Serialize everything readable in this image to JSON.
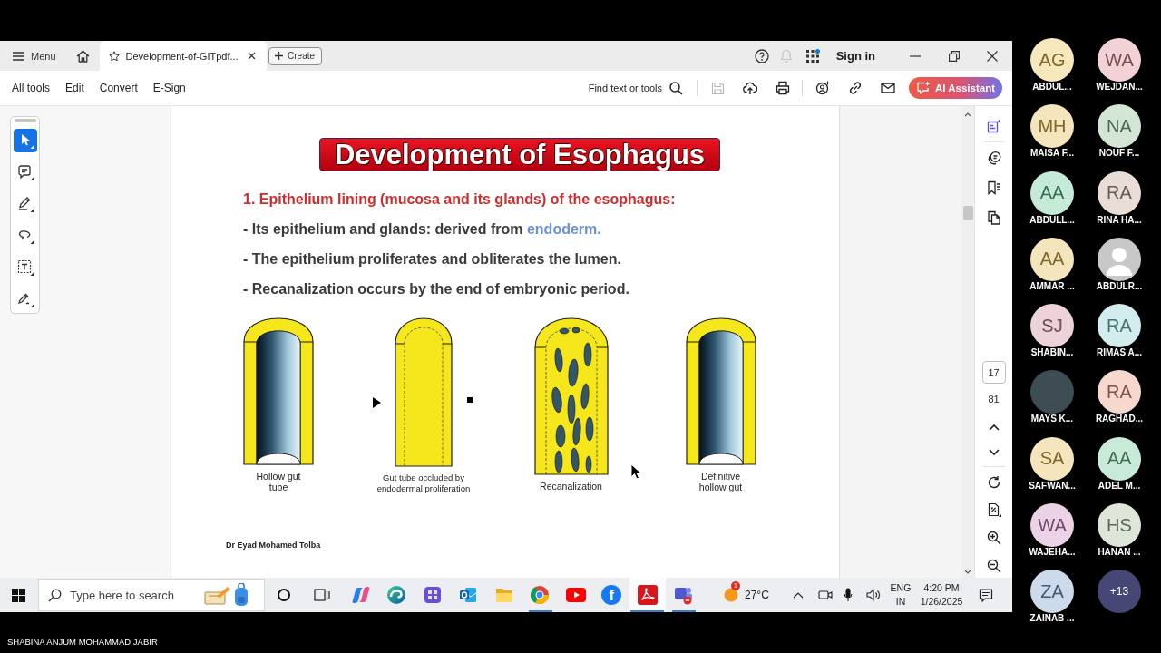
{
  "window": {
    "tab_bar": {
      "menu_label": "Menu",
      "tabs": [
        {
          "title": "Development-of-GITpdf...",
          "selected": true
        }
      ],
      "create_label": "Create",
      "notifications": {
        "disabled": true
      },
      "sign_in": "Sign in"
    },
    "toolbar": {
      "menu_items": [
        "All tools",
        "Edit",
        "Convert",
        "E-Sign"
      ],
      "find_label": "Find text or tools",
      "save": {
        "disabled": true
      },
      "ai_button": "AI Assistant"
    },
    "tools": [
      {
        "selected": true
      },
      {
        "selected": false
      },
      {
        "selected": false
      },
      {
        "selected": false
      },
      {
        "selected": false
      },
      {
        "selected": false
      }
    ],
    "page": {
      "title": "Development of Esophagus",
      "heading": "1. Epithelium lining (mucosa and its glands) of the esophagus:",
      "lines": [
        {
          "text": "- Its epithelium and glands: derived from",
          "highlight": "endoderm."
        },
        {
          "text": "- The epithelium proliferates and obliterates the lumen."
        },
        {
          "text": "- Recanalization occurs by the end of embryonic period."
        }
      ],
      "figures": [
        {
          "kind": "hollow",
          "caption": "Hollow gut tube"
        },
        {
          "kind": "occluded",
          "caption": "Gut tube occluded by endodermal proliferation"
        },
        {
          "kind": "recanalized",
          "caption": "Recanalization"
        },
        {
          "kind": "hollow",
          "caption": "Definitive hollow gut"
        }
      ],
      "footer": "Dr Eyad Mohamed Tolba"
    },
    "page_nav": {
      "page_field": {
        "value": "17"
      },
      "total": "81"
    }
  },
  "taskbar": {
    "search": {
      "placeholder": "Type here to search"
    },
    "apps": [
      {
        "running": false,
        "selected": false
      },
      {
        "running": false,
        "selected": false
      },
      {
        "running": false,
        "selected": false
      },
      {
        "running": false,
        "selected": false
      },
      {
        "running": false,
        "selected": false
      },
      {
        "running": true,
        "selected": false
      },
      {
        "running": false,
        "selected": false
      },
      {
        "running": false,
        "selected": false,
        "label": "f"
      },
      {
        "running": true,
        "selected": true
      },
      {
        "running": true,
        "selected": false
      }
    ],
    "weather": {
      "badge": "1",
      "temperature": "27°C"
    },
    "input_language": "ENG",
    "input_region": "IN",
    "time": "4:20 PM",
    "date": "1/26/2025"
  },
  "participants": [
    {
      "kind": "initials",
      "initials": "AG",
      "name": "ABDUL...",
      "color": "#f6e7bd"
    },
    {
      "kind": "initials",
      "initials": "MH",
      "name": "MAISA F...",
      "color": "#f5e5bc"
    },
    {
      "kind": "initials",
      "initials": "AA",
      "name": "ABDULL...",
      "color": "#c6ead8"
    },
    {
      "kind": "initials",
      "initials": "AA",
      "name": "AMMAR ...",
      "color": "#f5e5bc"
    },
    {
      "kind": "initials",
      "initials": "SJ",
      "name": "SHABIN...",
      "color": "#ecd3d9"
    },
    {
      "kind": "photo",
      "name": "MAYS K...",
      "color": "#3e4c54"
    },
    {
      "kind": "initials",
      "initials": "SA",
      "name": "SAFWAN...",
      "color": "#f5e5bc"
    },
    {
      "kind": "initials",
      "initials": "WA",
      "name": "WAJEHA...",
      "color": "#ecd2e7"
    },
    {
      "kind": "initials",
      "initials": "ZA",
      "name": "ZAINAB ...",
      "color": "#cddaeb"
    },
    {
      "kind": "initials",
      "initials": "WA",
      "name": "WEJDAN...",
      "color": "#f3d2d7"
    },
    {
      "kind": "initials",
      "initials": "NA",
      "name": "NOUF F...",
      "color": "#d3e6d6"
    },
    {
      "kind": "initials",
      "initials": "RA",
      "name": "RINA HA...",
      "color": "#e9ddd7"
    },
    {
      "kind": "silhouette",
      "name": "ABDULR...",
      "color": "#c8c8c8"
    },
    {
      "kind": "initials",
      "initials": "RA",
      "name": "RIMAS A...",
      "color": "#d3eced"
    },
    {
      "kind": "initials",
      "initials": "RA",
      "name": "RAGHAD...",
      "color": "#f7d8cf"
    },
    {
      "kind": "initials",
      "initials": "AA",
      "name": "ADEL M...",
      "color": "#c9ead8"
    },
    {
      "kind": "initials",
      "initials": "HS",
      "name": "HANAN ...",
      "color": "#dee5d9"
    },
    {
      "kind": "more",
      "label": "+13",
      "color": "#464775"
    }
  ],
  "presenter_name": "SHABINA ANJUM MOHAMMAD JABIR"
}
